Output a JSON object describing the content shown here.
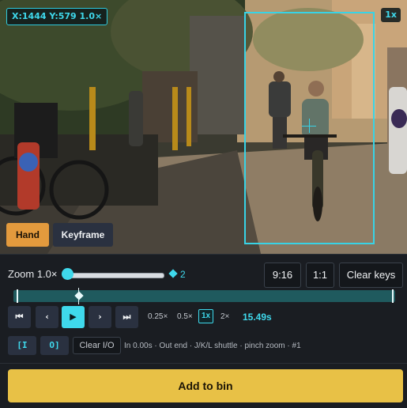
{
  "viewer": {
    "coord_readout": "X:1444 Y:579 1.0×",
    "speed_badge": "1x",
    "mode_hand": "Hand",
    "mode_keyframe": "Keyframe"
  },
  "zoom": {
    "label": "Zoom 1.0×",
    "value": 0.0,
    "keyframe_count": "2"
  },
  "aspect": {
    "ratio_916": "9:16",
    "ratio_11": "1:1",
    "clear_keys": "Clear keys"
  },
  "transport": {
    "go_start": "⏮",
    "step_back": "‹",
    "play": "▶",
    "step_forward": "›",
    "go_end": "⏭",
    "rates": [
      "0.25×",
      "0.5×",
      "1x",
      "2×"
    ],
    "active_rate": "1x",
    "time": "15.49s"
  },
  "io": {
    "mark_in": "[I",
    "mark_out": "O]",
    "clear": "Clear I/O",
    "status": "In 0.00s · Out end · J/K/L shuttle · pinch zoom · #1"
  },
  "actions": {
    "add_to_bin": "Add to bin"
  },
  "colors": {
    "accent": "#3fd9ec",
    "hand_active": "#e39a3d",
    "add_button": "#e8c146"
  }
}
